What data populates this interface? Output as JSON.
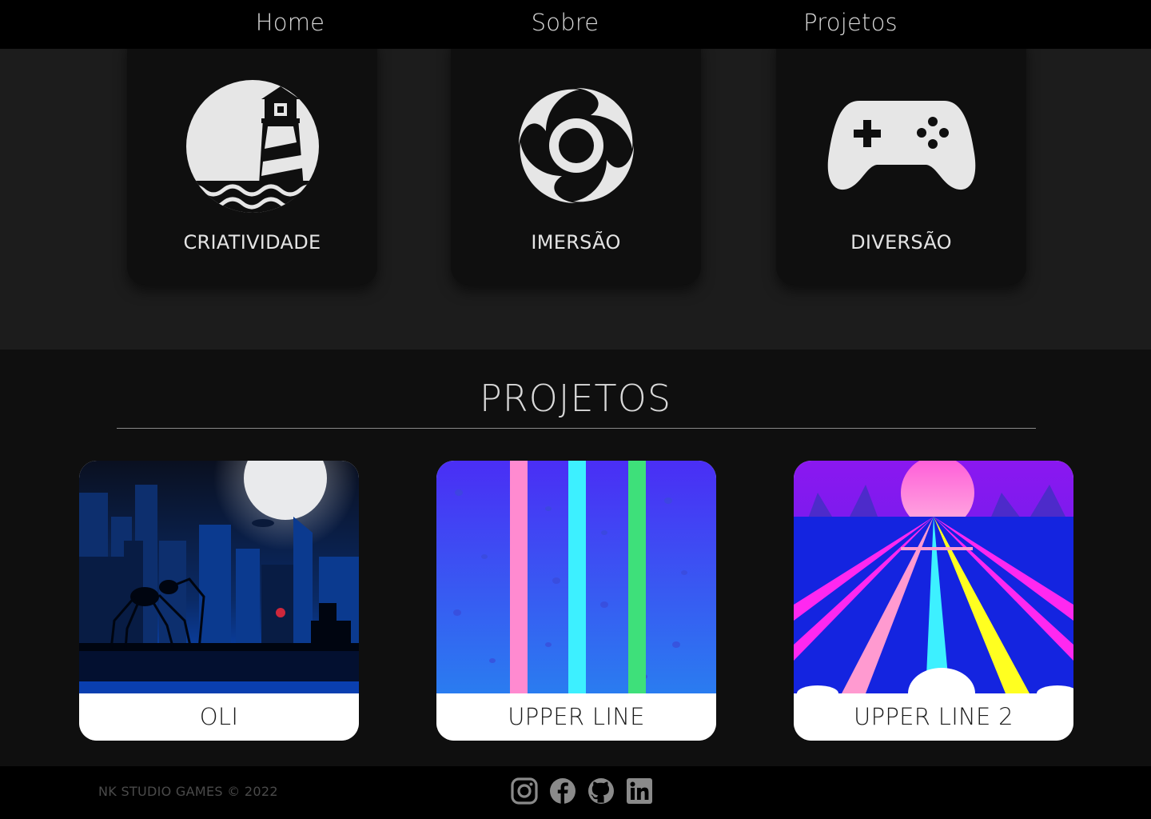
{
  "nav": {
    "links": [
      "Home",
      "Sobre",
      "Projetos"
    ]
  },
  "features": [
    {
      "label": "CRIATIVIDADE",
      "icon": "lighthouse-icon"
    },
    {
      "label": "IMERSÃO",
      "icon": "vortex-icon"
    },
    {
      "label": "DIVERSÃO",
      "icon": "gamepad-icon"
    }
  ],
  "projects": {
    "title": "PROJETOS",
    "items": [
      {
        "title": "OLI",
        "image": "oli-cover-image"
      },
      {
        "title": "UPPER LINE",
        "image": "upper-line-cover-image"
      },
      {
        "title": "UPPER LINE 2",
        "image": "upper-line-2-cover-image"
      }
    ]
  },
  "footer": {
    "copyright": "NK STUDIO GAMES © 2022",
    "social_icons": [
      "instagram-icon",
      "facebook-icon",
      "github-icon",
      "linkedin-icon"
    ]
  },
  "colors": {
    "nav_bg": "#000000",
    "features_bg": "#1c1c1c",
    "card_bg": "#0f0f0f",
    "projects_bg": "#0f0f0f",
    "icon_fill": "#e6e6e6",
    "footer_text": "#4a4a4a",
    "social_icon": "#8a8a8a"
  }
}
